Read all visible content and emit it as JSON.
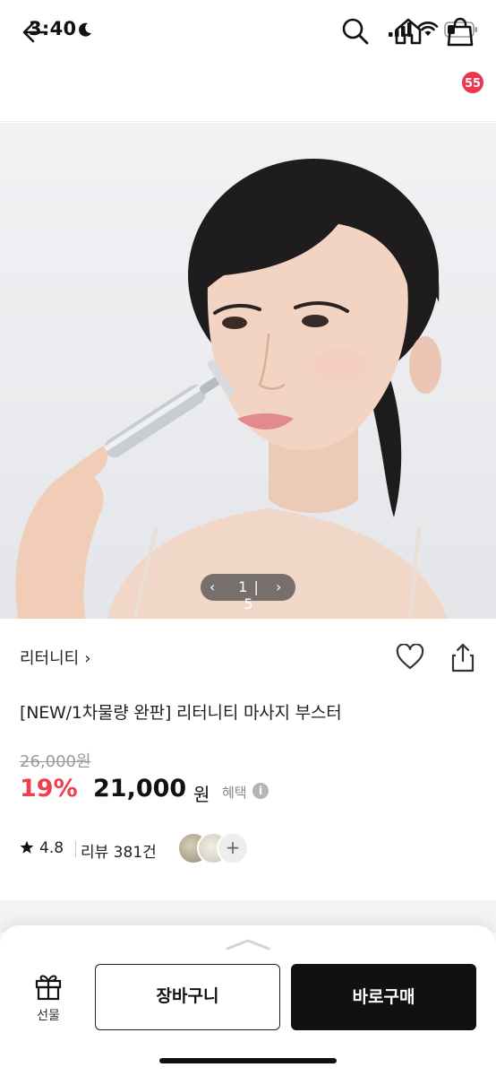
{
  "status_bar": {
    "time": "3:40"
  },
  "nav": {
    "cart_count": "55"
  },
  "hero": {
    "pager_text": "1 | 5"
  },
  "product": {
    "brand": "리터니티",
    "title": "[NEW/1차물량 완판] 리터니티 마사지 부스터",
    "original_price": "26,000원",
    "discount": "19%",
    "sale_price": "21,000",
    "currency": "원",
    "benefit_label": "혜택",
    "rating": "4.8",
    "review_text": "리뷰 381건"
  },
  "bottom_bar": {
    "gift_label": "선물",
    "cart_label": "장바구니",
    "buy_label": "바로구매"
  },
  "colors": {
    "accent": "#ef3f4f",
    "badge": "#f0364f",
    "primary_button": "#111111"
  }
}
